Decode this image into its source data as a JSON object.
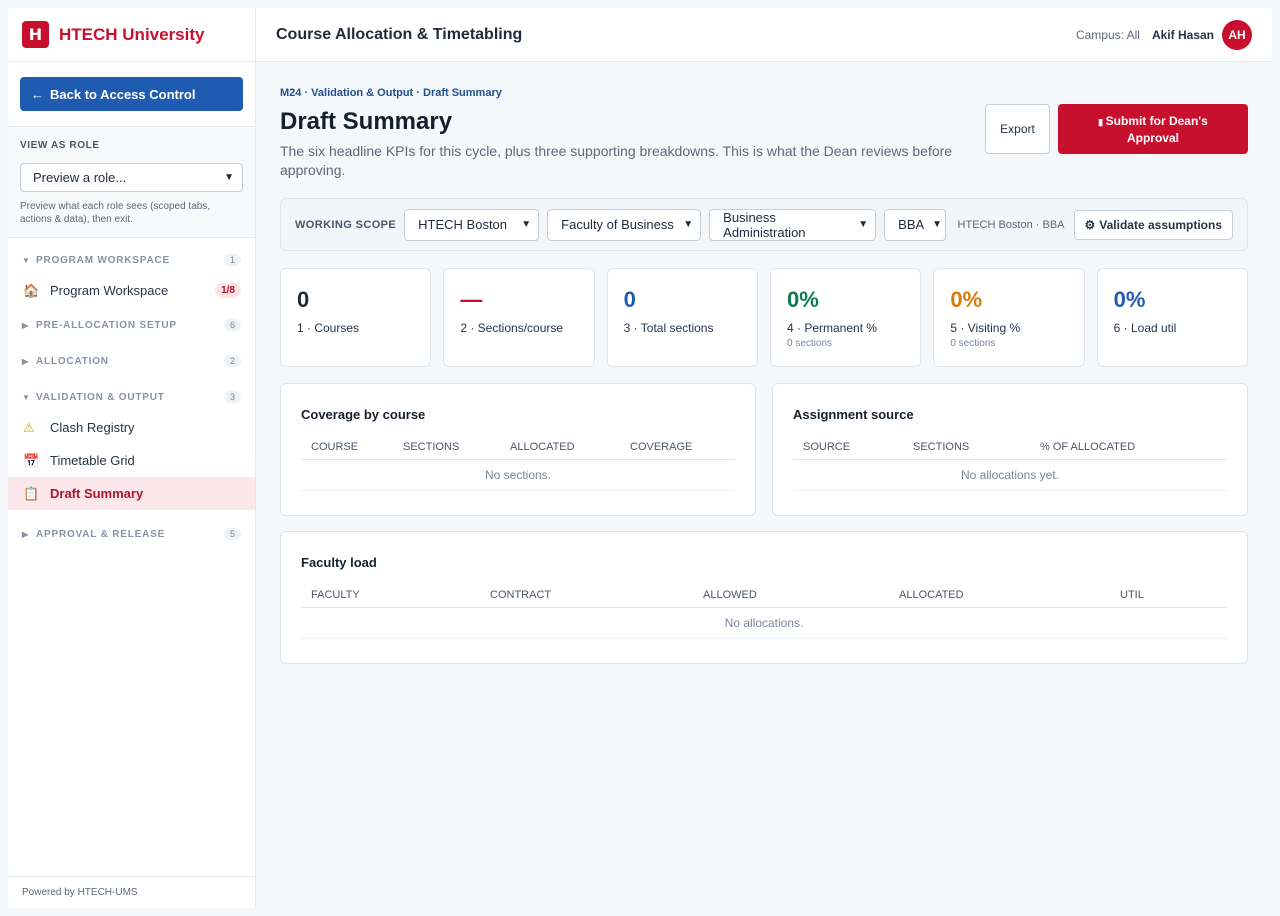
{
  "brand": {
    "logo_letter": "H",
    "name": "HTECH University"
  },
  "sidebar": {
    "back_label": "Back to Access Control",
    "role": {
      "title": "VIEW AS ROLE",
      "select_value": "Preview a role...",
      "help": "Preview what each role sees (scoped tabs, actions & data), then exit."
    },
    "sections": [
      {
        "label": "PROGRAM WORKSPACE",
        "count": "1",
        "expanded": true
      },
      {
        "label": "PRE-ALLOCATION SETUP",
        "count": "6",
        "expanded": false
      },
      {
        "label": "ALLOCATION",
        "count": "2",
        "expanded": false
      },
      {
        "label": "VALIDATION & OUTPUT",
        "count": "3",
        "expanded": true
      },
      {
        "label": "APPROVAL & RELEASE",
        "count": "5",
        "expanded": false
      }
    ],
    "items": {
      "program_workspace": {
        "label": "Program Workspace",
        "badge": "1/8",
        "icon": "house-icon"
      },
      "clash_registry": {
        "label": "Clash Registry",
        "icon": "warning-icon"
      },
      "timetable_grid": {
        "label": "Timetable Grid",
        "icon": "calendar-icon"
      },
      "draft_summary": {
        "label": "Draft Summary",
        "icon": "clipboard-icon"
      }
    },
    "footer": "Powered by HTECH-UMS"
  },
  "topbar": {
    "title": "Course Allocation & Timetabling",
    "campus": "Campus: All",
    "user": "Akif Hasan",
    "initials": "AH"
  },
  "page": {
    "breadcrumb": "M24 · Validation & Output · Draft Summary",
    "title": "Draft Summary",
    "subtitle": "The six headline KPIs for this cycle, plus three supporting breakdowns. This is what the Dean reviews before approving.",
    "export_label": "Export",
    "submit_label": "Submit for Dean's Approval"
  },
  "scope": {
    "label": "WORKING SCOPE",
    "campus": "HTECH Boston",
    "faculty": "Faculty of Business",
    "department": "Business Administration",
    "program": "BBA",
    "context": "HTECH Boston · BBA",
    "validate_label": "Validate assumptions"
  },
  "kpis": [
    {
      "value": "0",
      "caption": "1 · Courses",
      "note": "",
      "color": "#1f2a3a"
    },
    {
      "value": "—",
      "caption": "2 · Sections/course",
      "note": "",
      "color": "#c8102e"
    },
    {
      "value": "0",
      "caption": "3 · Total sections",
      "note": "",
      "color": "#1f5bb0"
    },
    {
      "value": "0%",
      "caption": "4 · Permanent %",
      "note": "0 sections",
      "color": "#0f7a4f"
    },
    {
      "value": "0%",
      "caption": "5 · Visiting %",
      "note": "0 sections",
      "color": "#d97b0b"
    },
    {
      "value": "0%",
      "caption": "6 · Load util",
      "note": "",
      "color": "#1f5bb0"
    }
  ],
  "coverage": {
    "title": "Coverage by course",
    "columns": [
      "COURSE",
      "SECTIONS",
      "ALLOCATED",
      "COVERAGE"
    ],
    "empty": "No sections."
  },
  "assignment": {
    "title": "Assignment source",
    "columns": [
      "SOURCE",
      "SECTIONS",
      "% OF ALLOCATED"
    ],
    "empty": "No allocations yet."
  },
  "faculty_load": {
    "title": "Faculty load",
    "columns": [
      "FACULTY",
      "CONTRACT",
      "ALLOWED",
      "ALLOCATED",
      "UTIL"
    ],
    "empty": "No allocations."
  }
}
